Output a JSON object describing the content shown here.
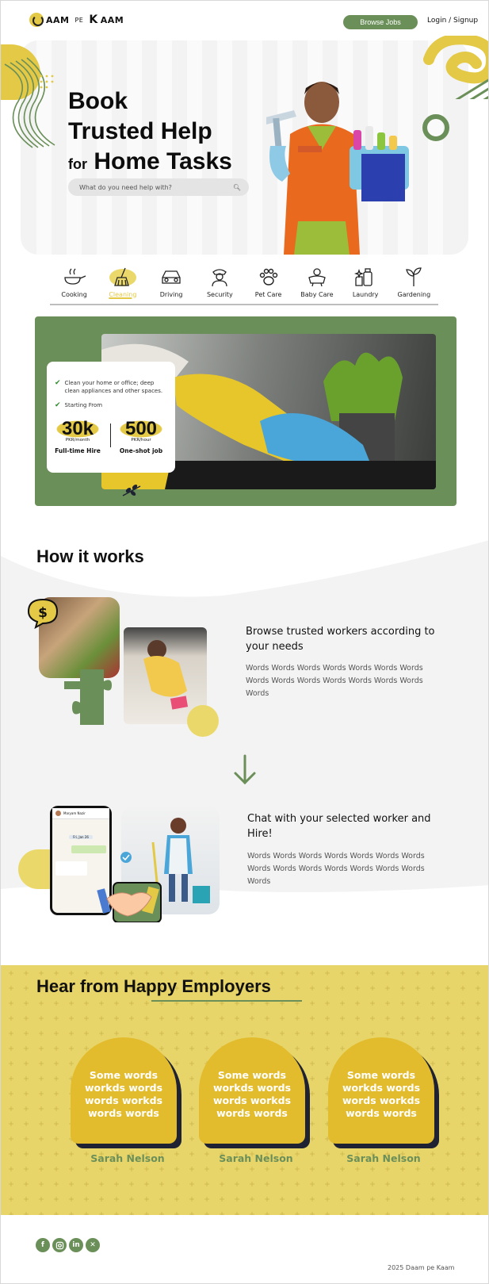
{
  "header": {
    "logo_part1": "AAM",
    "logo_part2": "PE",
    "logo_part3": "K",
    "logo_part4": "AAM",
    "browse_jobs": "Browse Jobs",
    "login": "Login / Signup"
  },
  "hero": {
    "line1": "Book",
    "line2": "Trusted Help",
    "line3_small": "for",
    "line3_big": "Home Tasks",
    "search_placeholder": "What do you need help with?"
  },
  "categories": [
    {
      "label": "Cooking",
      "icon": "cooking-pot-icon"
    },
    {
      "label": "Cleaning",
      "icon": "broom-icon",
      "active": true
    },
    {
      "label": "Driving",
      "icon": "car-icon"
    },
    {
      "label": "Security",
      "icon": "guard-icon"
    },
    {
      "label": "Pet Care",
      "icon": "paw-icon"
    },
    {
      "label": "Baby Care",
      "icon": "baby-icon"
    },
    {
      "label": "Laundry",
      "icon": "detergent-icon"
    },
    {
      "label": "Gardening",
      "icon": "sprout-icon"
    }
  ],
  "promo": {
    "point1": "Clean your home or office; deep clean appliances and other spaces.",
    "point2": "Starting From",
    "stat1_value": "30k",
    "stat1_unit": "PKR/month",
    "stat1_caption": "Full-time Hire",
    "stat2_value": "500",
    "stat2_unit": "PKR/hour",
    "stat2_caption": "One-shot job"
  },
  "how": {
    "title": "How it works",
    "step1_title": "Browse trusted workers according to your needs",
    "step1_text": "Words Words Words Words Words Words Words Words Words Words Words Words Words Words Words",
    "step2_title": "Chat with your selected worker and Hire!",
    "step2_text": "Words Words Words Words Words Words Words Words Words Words Words Words Words Words Words",
    "chat_name": "Maryam Nazir",
    "chat_time": "Fri, Jan 26"
  },
  "reviews": {
    "title": "Hear from Happy Employers",
    "items": [
      {
        "text": "Some words workds words words workds words words",
        "name": "Sarah Nelson"
      },
      {
        "text": "Some words workds words words workds words words",
        "name": "Sarah Nelson"
      },
      {
        "text": "Some words workds words words workds words words",
        "name": "Sarah Nelson"
      }
    ]
  },
  "footer": {
    "copyright": "2025 Daam pe Kaam",
    "socials": [
      "facebook-icon",
      "instagram-icon",
      "linkedin-icon",
      "x-icon"
    ]
  },
  "colors": {
    "accent_green": "#6a8f58",
    "accent_yellow": "#e3c946",
    "card_yellow": "#e3bc2e"
  }
}
